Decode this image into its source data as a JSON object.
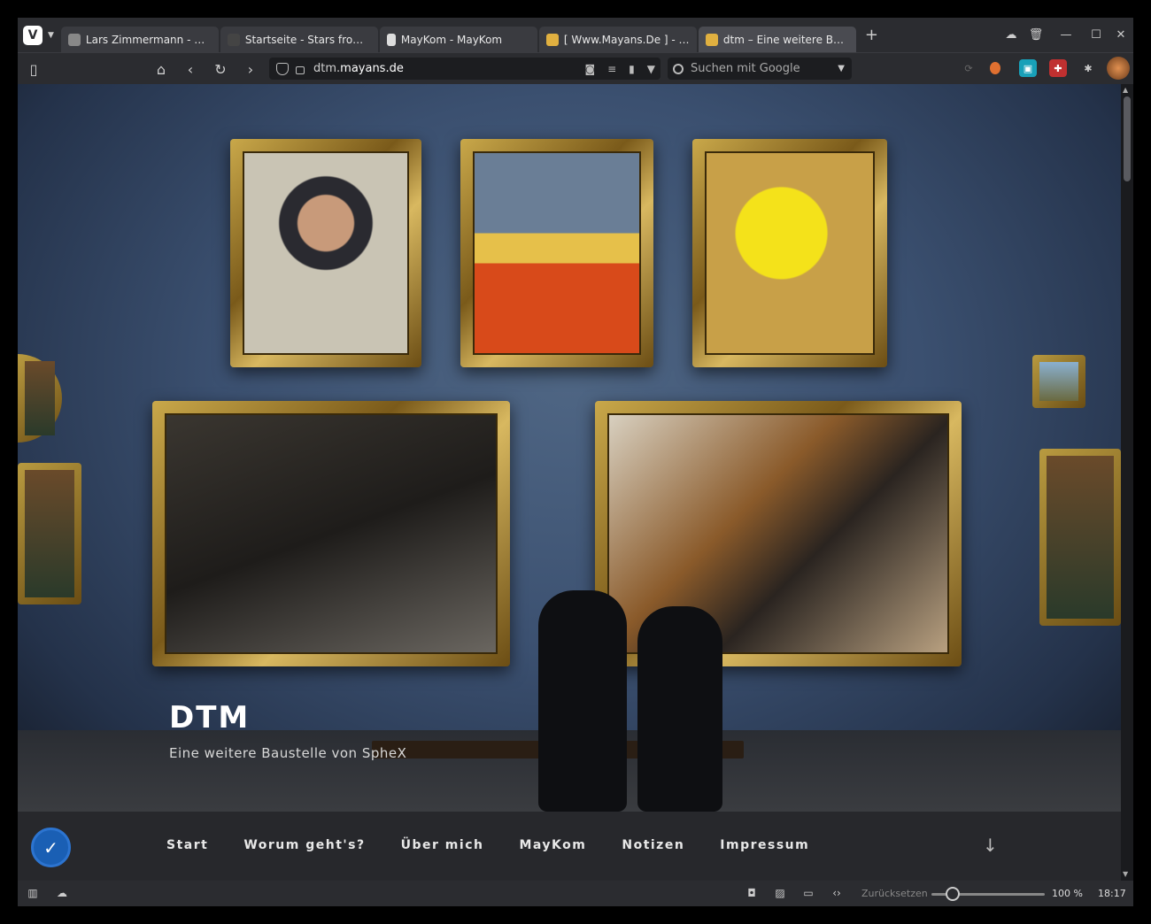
{
  "tabs": [
    {
      "title": "Lars Zimmermann - Arti…",
      "favicon": "avatar-icon",
      "color": "#888888"
    },
    {
      "title": "Startseite - Stars from th…",
      "favicon": "stars-icon",
      "color": "#444444"
    },
    {
      "title": "MayKom - MayKom",
      "favicon": "page-icon",
      "color": "#cccccc"
    },
    {
      "title": "[ Www.Mayans.De ] - Ma…",
      "favicon": "mayans-icon",
      "color": "#e0b040"
    },
    {
      "title": "dtm – Eine weitere Baustelle",
      "favicon": "mayans-icon",
      "color": "#e0b040",
      "active": true
    }
  ],
  "address": {
    "prefix": "dtm.",
    "host": "mayans.de"
  },
  "search": {
    "placeholder": "Suchen mit Google"
  },
  "hero": {
    "title": "DTM",
    "subtitle": "Eine weitere Baustelle von SpheX"
  },
  "nav": [
    "Start",
    "Worum geht's?",
    "Über mich",
    "MayKom",
    "Notizen",
    "Impressum"
  ],
  "status": {
    "reset_label": "Zurücksetzen",
    "zoom": "100 %",
    "time": "18:17"
  },
  "colors": {
    "accent": "#1a5fb4"
  }
}
